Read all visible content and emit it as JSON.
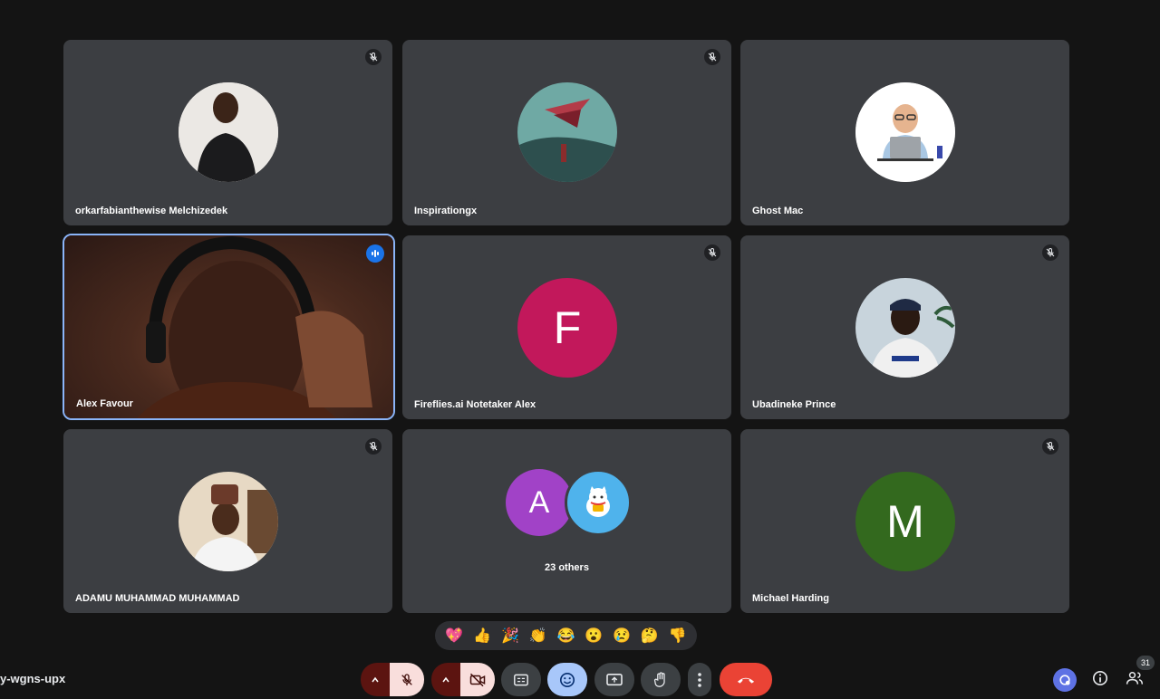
{
  "participants": [
    {
      "name": "orkarfabianthewise Melchizedek",
      "muted": true
    },
    {
      "name": "Inspirationgx",
      "muted": true
    },
    {
      "name": "Ghost Mac",
      "muted": false
    },
    {
      "name": "Alex Favour",
      "speaking": true
    },
    {
      "name": "Fireflies.ai Notetaker Alex",
      "muted": true,
      "initial": "F",
      "color": "#c2185b"
    },
    {
      "name": "Ubadineke Prince",
      "muted": true
    },
    {
      "name": "ADAMU MUHAMMAD MUHAMMAD",
      "muted": true
    },
    {
      "name": "Michael Harding",
      "muted": true,
      "initial": "M",
      "color": "#33691e"
    }
  ],
  "others": {
    "initial": "A",
    "label": "23 others"
  },
  "reactions": [
    "💖",
    "👍",
    "🎉",
    "👏",
    "😂",
    "😮",
    "😢",
    "🤔",
    "👎"
  ],
  "meeting_code": "y-wgns-upx",
  "participants_count": "31",
  "colors": {
    "accent": "#8ab4f8",
    "end_call": "#ea4335",
    "muted_bg": "#f9dedc",
    "tile_bg": "#3c3e42"
  }
}
